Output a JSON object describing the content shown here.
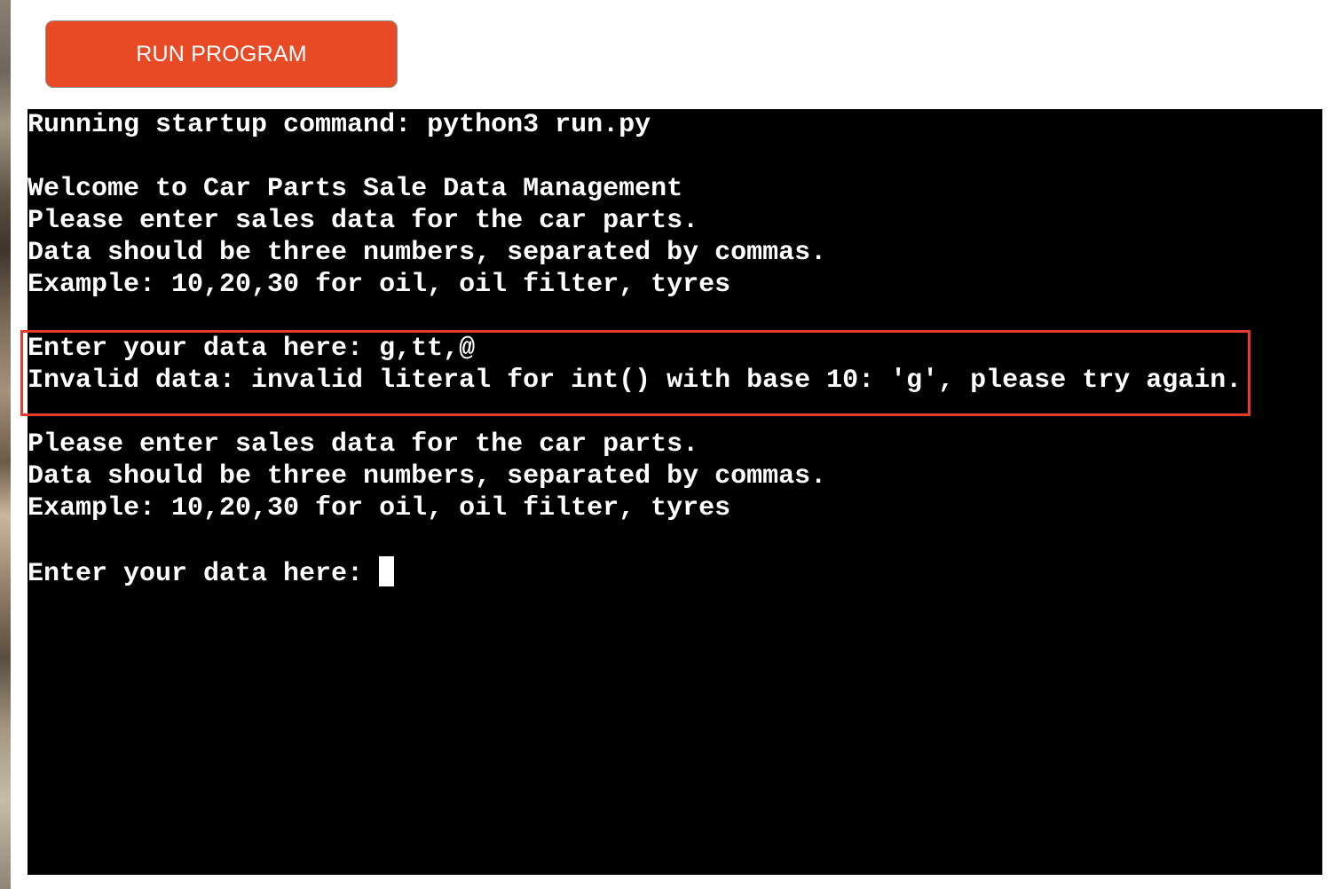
{
  "run_button": {
    "label": "RUN PROGRAM"
  },
  "terminal": {
    "lines": [
      "Running startup command: python3 run.py",
      "",
      "Welcome to Car Parts Sale Data Management",
      "Please enter sales data for the car parts.",
      "Data should be three numbers, separated by commas.",
      "Example: 10,20,30 for oil, oil filter, tyres",
      "",
      "Enter your data here: g,tt,@",
      "Invalid data: invalid literal for int() with base 10: 'g', please try again.",
      "",
      "Please enter sales data for the car parts.",
      "Data should be three numbers, separated by commas.",
      "Example: 10,20,30 for oil, oil filter, tyres",
      "",
      "Enter your data here: "
    ]
  },
  "colors": {
    "button_bg": "#e84a26",
    "terminal_bg": "#000000",
    "terminal_text": "#ffffff",
    "highlight_border": "#e53b2c"
  }
}
